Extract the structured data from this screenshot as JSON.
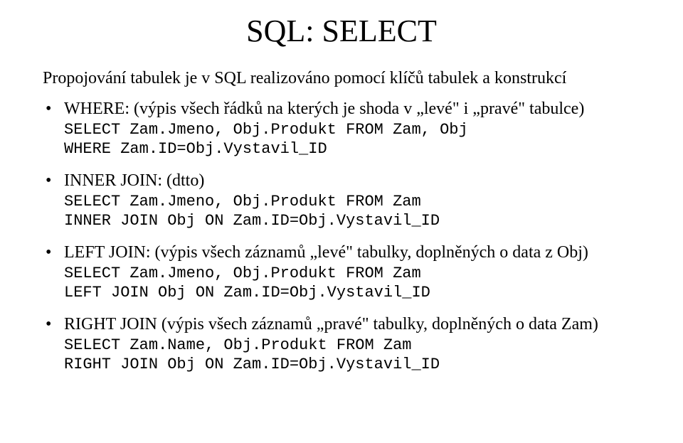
{
  "title": "SQL: SELECT",
  "intro": "Propojování tabulek je v SQL realizováno pomocí klíčů tabulek a konstrukcí",
  "items": [
    {
      "desc": "WHERE: (výpis všech řádků na kterých je shoda v „levé\" i „pravé\" tabulce)",
      "code": "SELECT Zam.Jmeno, Obj.Produkt FROM Zam, Obj\nWHERE Zam.ID=Obj.Vystavil_ID"
    },
    {
      "desc": "INNER JOIN: (dtto)",
      "code": "SELECT Zam.Jmeno, Obj.Produkt FROM Zam\nINNER JOIN Obj ON Zam.ID=Obj.Vystavil_ID"
    },
    {
      "desc": "LEFT JOIN: (výpis všech záznamů „levé\" tabulky, doplněných o data z Obj)",
      "code": "SELECT Zam.Jmeno, Obj.Produkt FROM Zam\nLEFT JOIN Obj ON Zam.ID=Obj.Vystavil_ID"
    },
    {
      "desc": "RIGHT JOIN (výpis všech záznamů „pravé\" tabulky, doplněných o data Zam)",
      "code": "SELECT Zam.Name, Obj.Produkt FROM Zam\nRIGHT JOIN Obj ON Zam.ID=Obj.Vystavil_ID"
    }
  ]
}
